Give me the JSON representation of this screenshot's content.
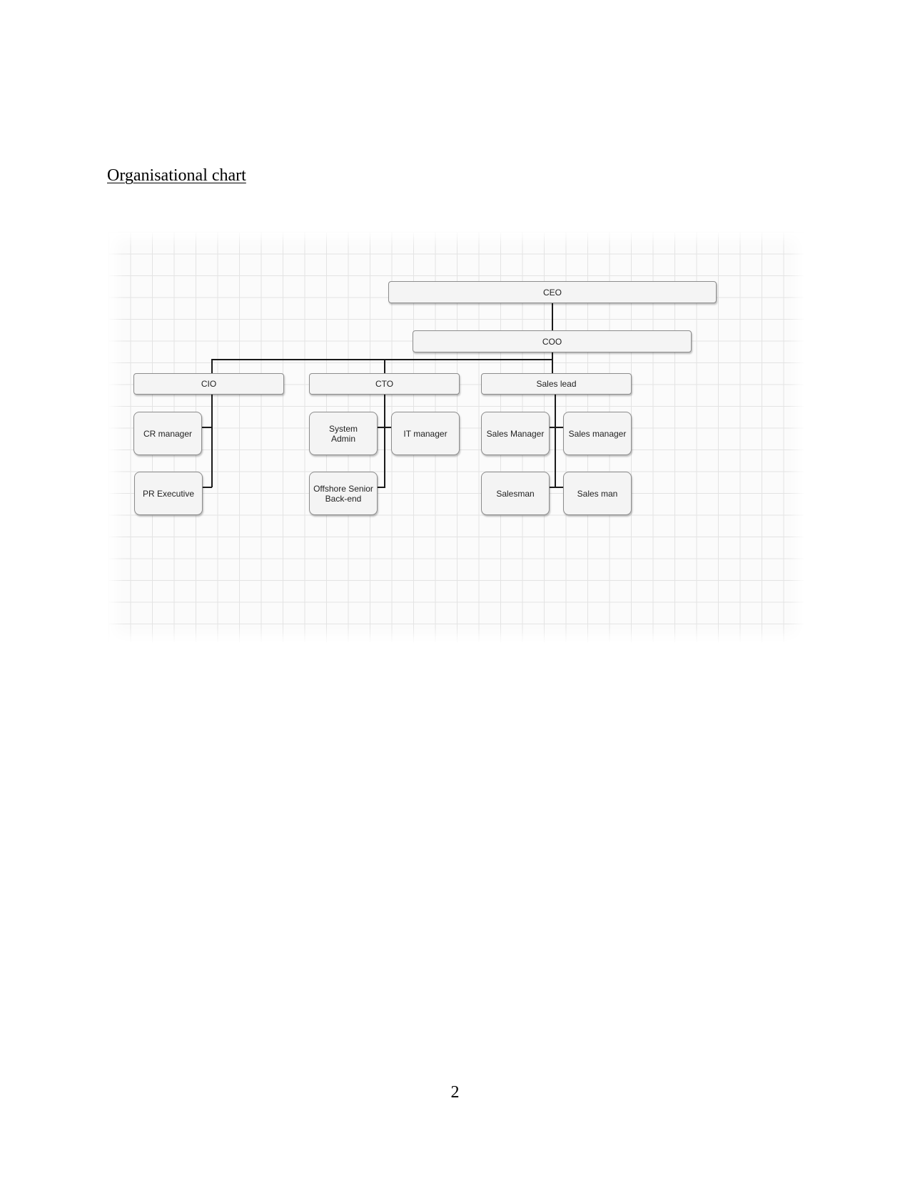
{
  "document": {
    "heading": "Organisational chart",
    "page_number": "2"
  },
  "org_chart": {
    "ceo": "CEO",
    "coo": "COO",
    "departments": [
      {
        "head": "CIO",
        "members": [
          "CR manager",
          "PR Executive"
        ]
      },
      {
        "head": "CTO",
        "members": [
          "System\nAdmin",
          "IT manager",
          "Offshore Senior\nBack-end"
        ]
      },
      {
        "head": "Sales lead",
        "members": [
          "Sales Manager",
          "Sales manager",
          "Salesman",
          "Sales man"
        ]
      }
    ]
  },
  "colors": {
    "node_fill": "#f4f4f4",
    "node_border": "#8c8c8c",
    "connector": "#1a1a1a",
    "grid": "#e3e3e3"
  }
}
